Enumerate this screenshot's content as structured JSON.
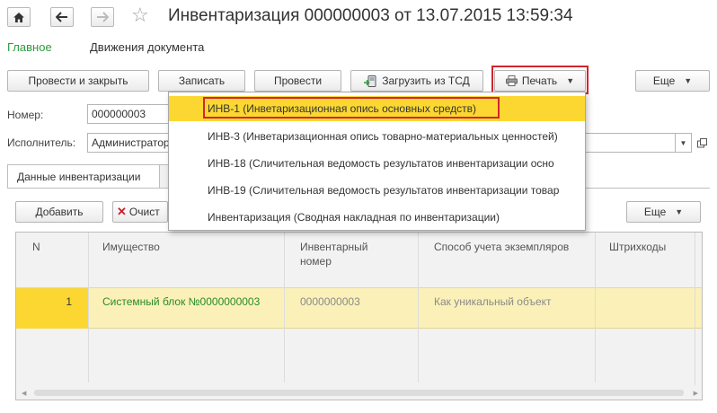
{
  "window": {
    "title": "Инвентаризация 000000003 от 13.07.2015 13:59:34"
  },
  "sections": {
    "main": "Главное",
    "movements": "Движения документа"
  },
  "toolbar": {
    "post_close": "Провести и закрыть",
    "save": "Записать",
    "post": "Провести",
    "load_tsd": "Загрузить из ТСД",
    "print": "Печать",
    "more": "Еще"
  },
  "form": {
    "number_label": "Номер:",
    "number_value": "000000003",
    "executor_label": "Исполнитель:",
    "executor_value": "Администратор"
  },
  "tabs": {
    "inventory_data": "Данные инвентаризации"
  },
  "table_toolbar": {
    "add": "Добавить",
    "clear": "Очист",
    "more": "Еще"
  },
  "table": {
    "headers": {
      "n": "N",
      "property": "Имущество",
      "inv_num_1": "Инвентарный",
      "inv_num_2": "номер",
      "accounting": "Способ учета экземпляров",
      "barcodes": "Штрихкоды"
    },
    "rows": [
      {
        "n": "1",
        "property": "Системный блок №0000000003",
        "inv_num": "0000000003",
        "accounting": "Как уникальный объект",
        "barcodes": ""
      }
    ]
  },
  "print_menu": {
    "items": [
      "ИНВ-1 (Инветаризационная опись основных средств)",
      "ИНВ-3 (Инветаризационная опись товарно-материальных ценностей)",
      "ИНВ-18 (Сличительная ведомость результатов инвентаризации осно",
      "ИНВ-19 (Сличительная ведомость результатов инвентаризации товар",
      "Инвентаризация (Сводная накладная по инвентаризации)"
    ]
  },
  "colors": {
    "accent_green": "#2a9c3b",
    "selection_yellow": "#fcd731",
    "row_highlight": "#fbf1b8",
    "highlight_red": "#d3242d"
  }
}
